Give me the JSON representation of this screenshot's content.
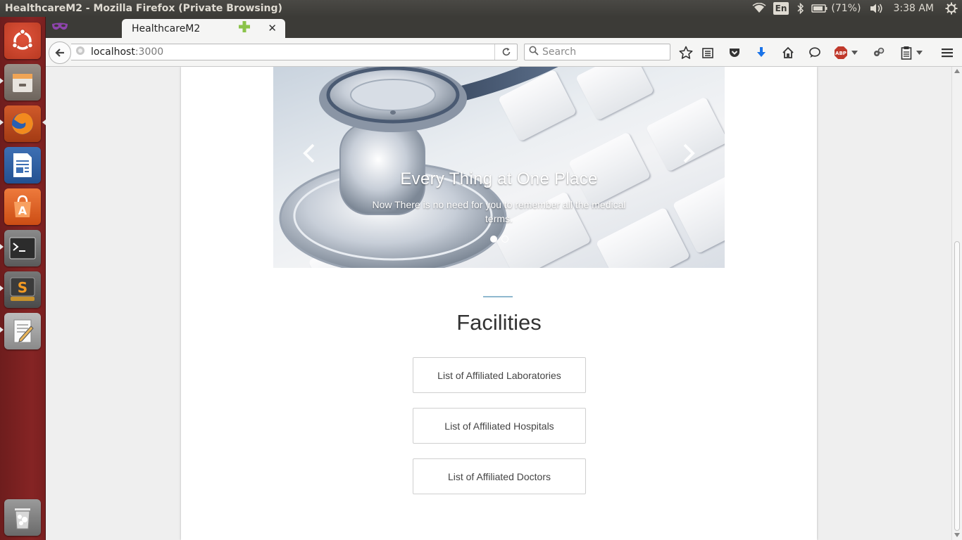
{
  "window": {
    "title": "HealthcareM2 - Mozilla Firefox (Private Browsing)"
  },
  "top_panel": {
    "language": "En",
    "battery_percent": "(71%)",
    "clock": "3:38 AM",
    "icons": [
      "wifi-icon",
      "bluetooth-icon",
      "battery-icon",
      "volume-icon",
      "gear-icon"
    ]
  },
  "launcher": {
    "items": [
      "ubuntu-dash",
      "files",
      "firefox",
      "libreoffice-writer",
      "ubuntu-software-center",
      "terminal",
      "sublime-text",
      "text-editor",
      "trash"
    ]
  },
  "browser": {
    "tab_title": "HealthcareM2",
    "url_host": "localhost",
    "url_port": ":3000",
    "search_placeholder": "Search"
  },
  "page": {
    "carousel": {
      "title": "Every Thing at One Place",
      "text": "Now There is no need for you to remember all the medical terms.",
      "slide_count": 2,
      "active_slide": 1
    },
    "section_title": "Facilities",
    "facility_buttons": [
      "List of Affiliated Laboratories",
      "List of Affiliated Hospitals",
      "List of Affiliated Doctors"
    ]
  },
  "colors": {
    "panel": "#3c3b37",
    "launcher": "#852424",
    "accent_line": "#8fb8cf",
    "abp_red": "#c0392b",
    "download_blue": "#1a73e8"
  }
}
